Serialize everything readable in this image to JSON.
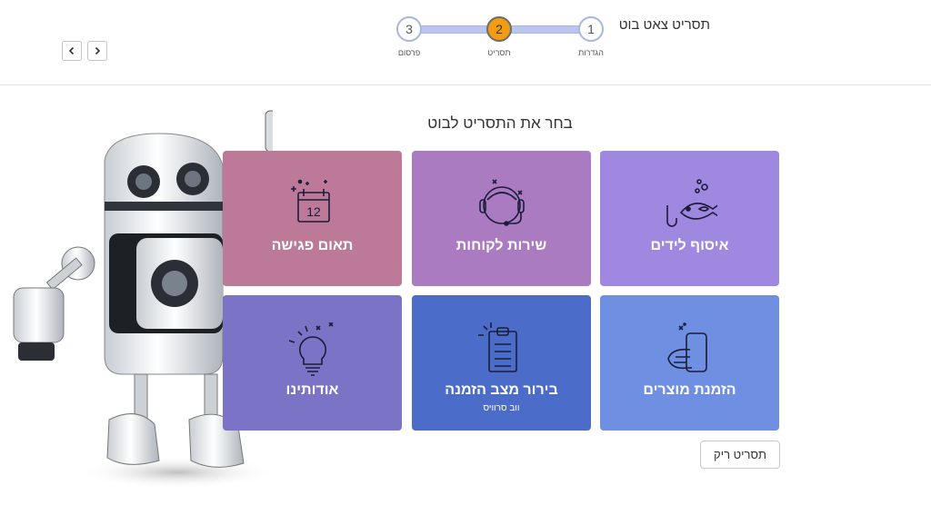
{
  "header": {
    "title": "תסריט צאט בוט",
    "steps": [
      {
        "number": "1",
        "label": "הגדרות"
      },
      {
        "number": "2",
        "label": "תסריט"
      },
      {
        "number": "3",
        "label": "פרסום"
      }
    ],
    "active_step": 2
  },
  "main": {
    "heading": "בחר את התסריט לבוט",
    "tiles": [
      {
        "label": "איסוף לידים",
        "icon": "fish-hook-icon",
        "color": "#9f88df"
      },
      {
        "label": "שירות לקוחות",
        "icon": "headset-agent-icon",
        "color": "#ab7bc2"
      },
      {
        "label": "תאום פגישה",
        "icon": "calendar-icon",
        "color": "#bc7a98",
        "calendar_day": "12"
      },
      {
        "label": "הזמנת מוצרים",
        "icon": "phone-tap-icon",
        "color": "#6e8fe2"
      },
      {
        "label": "בירור מצב הזמנה",
        "sub": "ווב סרוויס",
        "icon": "clipboard-icon",
        "color": "#4c6cca"
      },
      {
        "label": "אודותינו",
        "icon": "lightbulb-icon",
        "color": "#7a73c6"
      }
    ],
    "empty_script_label": "תסריט ריק"
  },
  "colors": {
    "step_active": "#f39c12",
    "stepper_line": "#b9c6ee"
  }
}
